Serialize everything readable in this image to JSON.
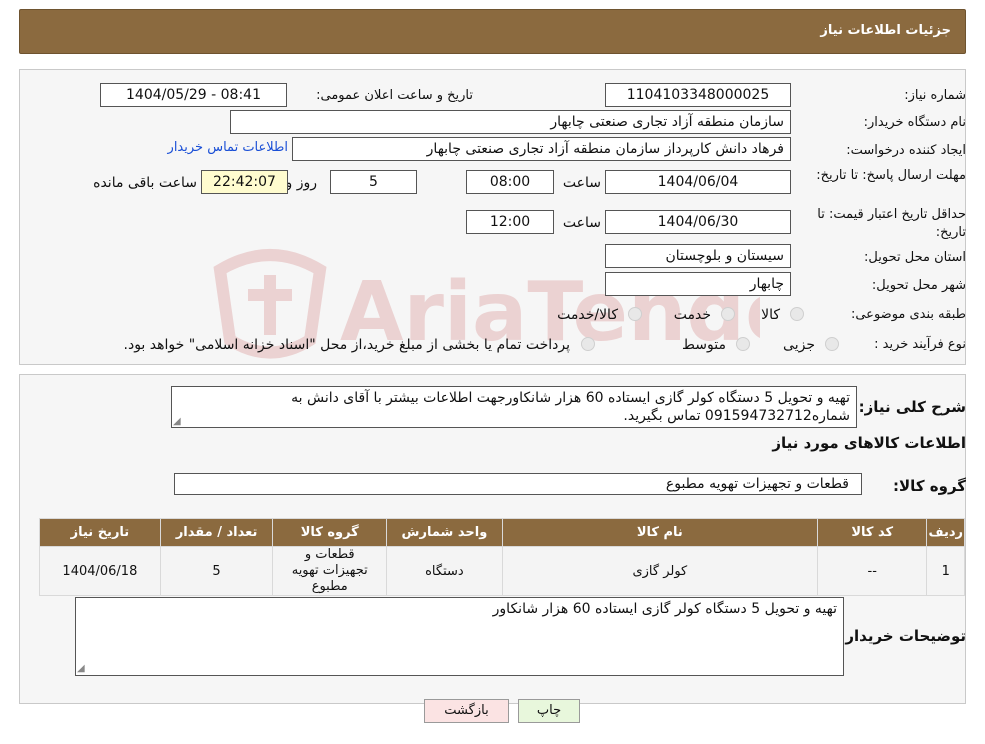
{
  "header": {
    "title": "جزئیات اطلاعات نیاز"
  },
  "fields": {
    "need_number_label": "شماره نیاز:",
    "need_number": "1104103348000025",
    "announce_label": "تاریخ و ساعت اعلان عمومی:",
    "announce_value": "1404/05/29 - 08:41",
    "buyer_org_label": "نام دستگاه خریدار:",
    "buyer_org": "سازمان منطقه آزاد تجاری صنعتی چابهار",
    "requester_label": "ایجاد کننده درخواست:",
    "requester": "فرهاد دانش کارپرداز سازمان منطقه آزاد تجاری صنعتی چابهار",
    "contact_link": "اطلاعات تماس خریدار",
    "reply_deadline_label": "مهلت ارسال پاسخ: تا تاریخ:",
    "reply_date": "1404/06/04",
    "time_label": "ساعت",
    "reply_time": "08:00",
    "days_value": "5",
    "days_label": "روز و",
    "remaining_value": "22:42:07",
    "remaining_label": "ساعت باقی مانده",
    "validity_label": "حداقل تاریخ اعتبار قیمت: تا تاریخ:",
    "validity_date": "1404/06/30",
    "validity_time": "12:00",
    "province_label": "استان محل تحویل:",
    "province": "سیستان و بلوچستان",
    "city_label": "شهر محل تحویل:",
    "city": "چابهار",
    "category_label": "طبقه بندی موضوعی:",
    "category_options": [
      "کالا",
      "خدمت",
      "کالا/خدمت"
    ],
    "process_label": "نوع فرآیند خرید :",
    "process_options": [
      "جزیی",
      "متوسط"
    ],
    "process_note": "پرداخت تمام یا بخشی از مبلغ خرید،از محل \"اسناد خزانه اسلامی\" خواهد بود."
  },
  "summary": {
    "label": "شرح کلی نیاز:",
    "text": "تهیه و تحویل 5 دستگاه کولر گازی ایستاده 60 هزار شانکاورجهت اطلاعات بیشتر با آقای دانش به شماره09159473271‌2 تماس بگیرید."
  },
  "goods": {
    "section_title": "اطلاعات کالاهای مورد نیاز",
    "group_label": "گروه کالا:",
    "group_value": "قطعات و تجهیزات تهویه مطبوع",
    "columns": [
      "ردیف",
      "کد کالا",
      "نام کالا",
      "واحد شمارش",
      "گروه کالا",
      "تعداد / مقدار",
      "تاریخ نیاز"
    ],
    "rows": [
      [
        "1",
        "--",
        "کولر گازی",
        "دستگاه",
        "قطعات و تجهیزات تهویه مطبوع",
        "5",
        "1404/06/18"
      ]
    ]
  },
  "buyer_notes": {
    "label": "توضیحات خریدار:",
    "text": "تهیه و تحویل 5 دستگاه کولر گازی ایستاده 60 هزار شانکاور"
  },
  "buttons": {
    "print": "چاپ",
    "back": "بازگشت"
  },
  "watermark": {
    "text": "AriaTender.neT"
  },
  "colors": {
    "header_bg": "#8b6a3f",
    "link": "#1a4fd6",
    "remaining_bg": "#fffccf",
    "back_btn_bg": "#fbe3e3",
    "print_btn_bg": "#e8f7dc"
  }
}
